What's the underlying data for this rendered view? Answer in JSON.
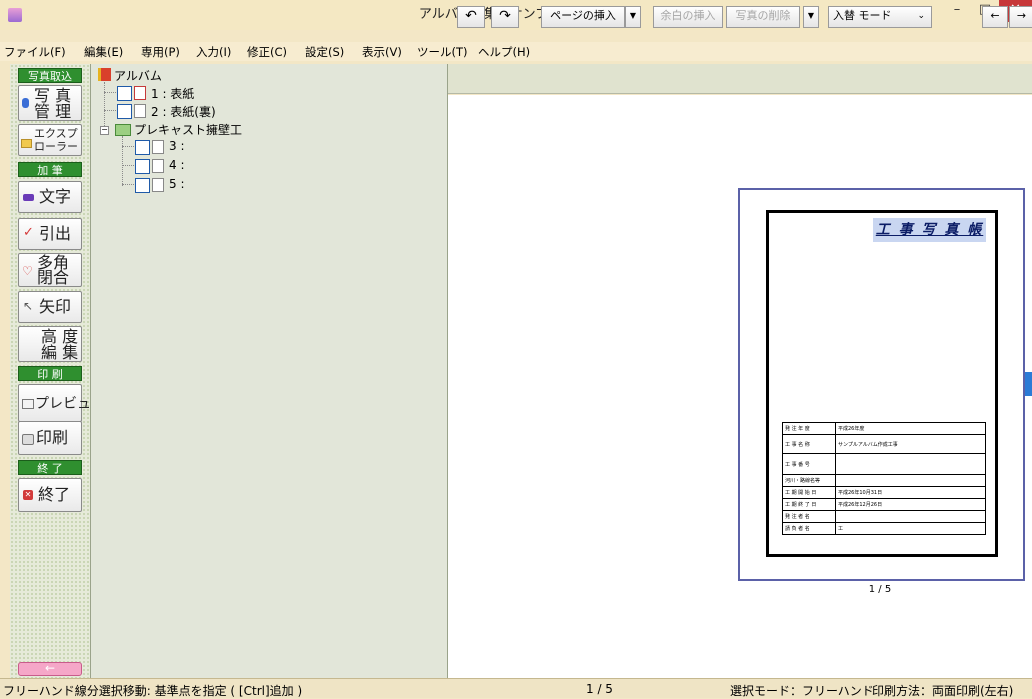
{
  "window": {
    "title": "アルバム編集 - サンプルアルバム",
    "min": "–",
    "max": "□",
    "close": "✕"
  },
  "menu": [
    "ファイル(F)",
    "編集(E)",
    "専用(P)",
    "入力(I)",
    "修正(C)",
    "設定(S)",
    "表示(V)",
    "ツール(T)",
    "ヘルプ(H)"
  ],
  "tools": {
    "photo_import_header": "写真取込",
    "photo_manage": "写 真\n管 理",
    "explorer": "エクスプ\nローラー",
    "add_header": "加 筆",
    "text": "文字",
    "leader": "引出",
    "polygon": "多角\n閉合",
    "arrow": "矢印",
    "advanced": "高 度\n編 集",
    "print_header": "印 刷",
    "preview": "プレビュ",
    "print": "印刷",
    "end_header": "終 了",
    "exit": "終了",
    "back": "←"
  },
  "tree": {
    "root": "アルバム",
    "p1": "1 : 表紙",
    "p2": "2 : 表紙(裏)",
    "group": "プレキャスト擁壁工",
    "p3": "3 :",
    "p4": "4 :",
    "p5": "5 :"
  },
  "toolbar": {
    "undo": "↶",
    "redo": "↷",
    "insert_page": "ページの挿入",
    "insert_margin": "余白の挿入",
    "delete_photo": "写真の削除",
    "mode": "入替 モード",
    "left": "←",
    "right": "→"
  },
  "page": {
    "title": "工 事 写 真 帳",
    "rows": [
      {
        "label": "発 注 年 度",
        "value": "平成26年度"
      },
      {
        "label": "工 事 名 称",
        "value": "サンプルアルバム作成工事"
      },
      {
        "label": "工 事 番 号",
        "value": ""
      },
      {
        "label": "河川・路線名等",
        "value": ""
      },
      {
        "label": "工 期 開 始 日",
        "value": "平成26年10月31日"
      },
      {
        "label": "工 期 終 了 日",
        "value": "平成26年12月26日"
      },
      {
        "label": "発 注 者 名",
        "value": ""
      },
      {
        "label": "請 負 者 名",
        "value": "工"
      }
    ],
    "counter": "1 / 5"
  },
  "status": {
    "hint": "フリーハンド線分選択移動: 基準点を指定 ( [Ctrl]追加 )",
    "page": "1 / 5",
    "select_mode": "選択モード：フリーハンド",
    "print_method": "印刷方法：両面印刷(左右)"
  },
  "colors": {
    "section_header": "#2f8f2f",
    "close_button": "#c7383a",
    "page_frame": "#5b61a8"
  }
}
